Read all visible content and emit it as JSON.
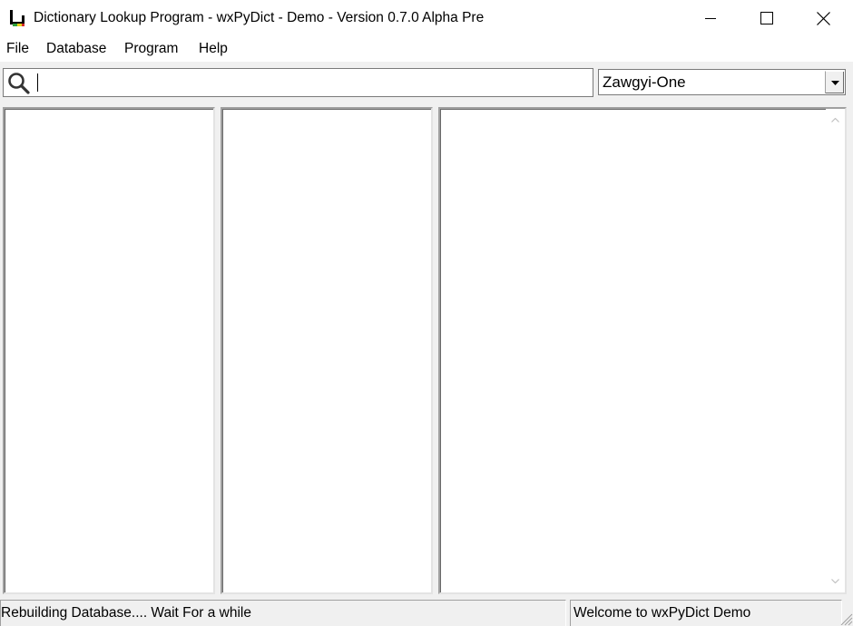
{
  "window": {
    "title": "Dictionary Lookup Program - wxPyDict - Demo - Version 0.7.0 Alpha Pre",
    "app_icon": "wxpydict-app-icon",
    "minimize_icon": "minimize-icon",
    "maximize_icon": "maximize-icon",
    "close_icon": "close-icon"
  },
  "menu": {
    "items": [
      {
        "label": "File"
      },
      {
        "label": "Database"
      },
      {
        "label": "Program"
      },
      {
        "label": "Help"
      }
    ]
  },
  "toolbar": {
    "search_icon": "search-icon",
    "search_value": "",
    "font_select": {
      "selected": "Zawgyi-One",
      "dropdown_icon": "dropdown-arrow-icon"
    }
  },
  "panes": {
    "word_list": {
      "items": []
    },
    "suggestion_list": {
      "items": []
    },
    "definition": {
      "text": ""
    }
  },
  "statusbar": {
    "left": "Rebuilding Database.... Wait For a while",
    "right": "Welcome to wxPyDict Demo"
  }
}
